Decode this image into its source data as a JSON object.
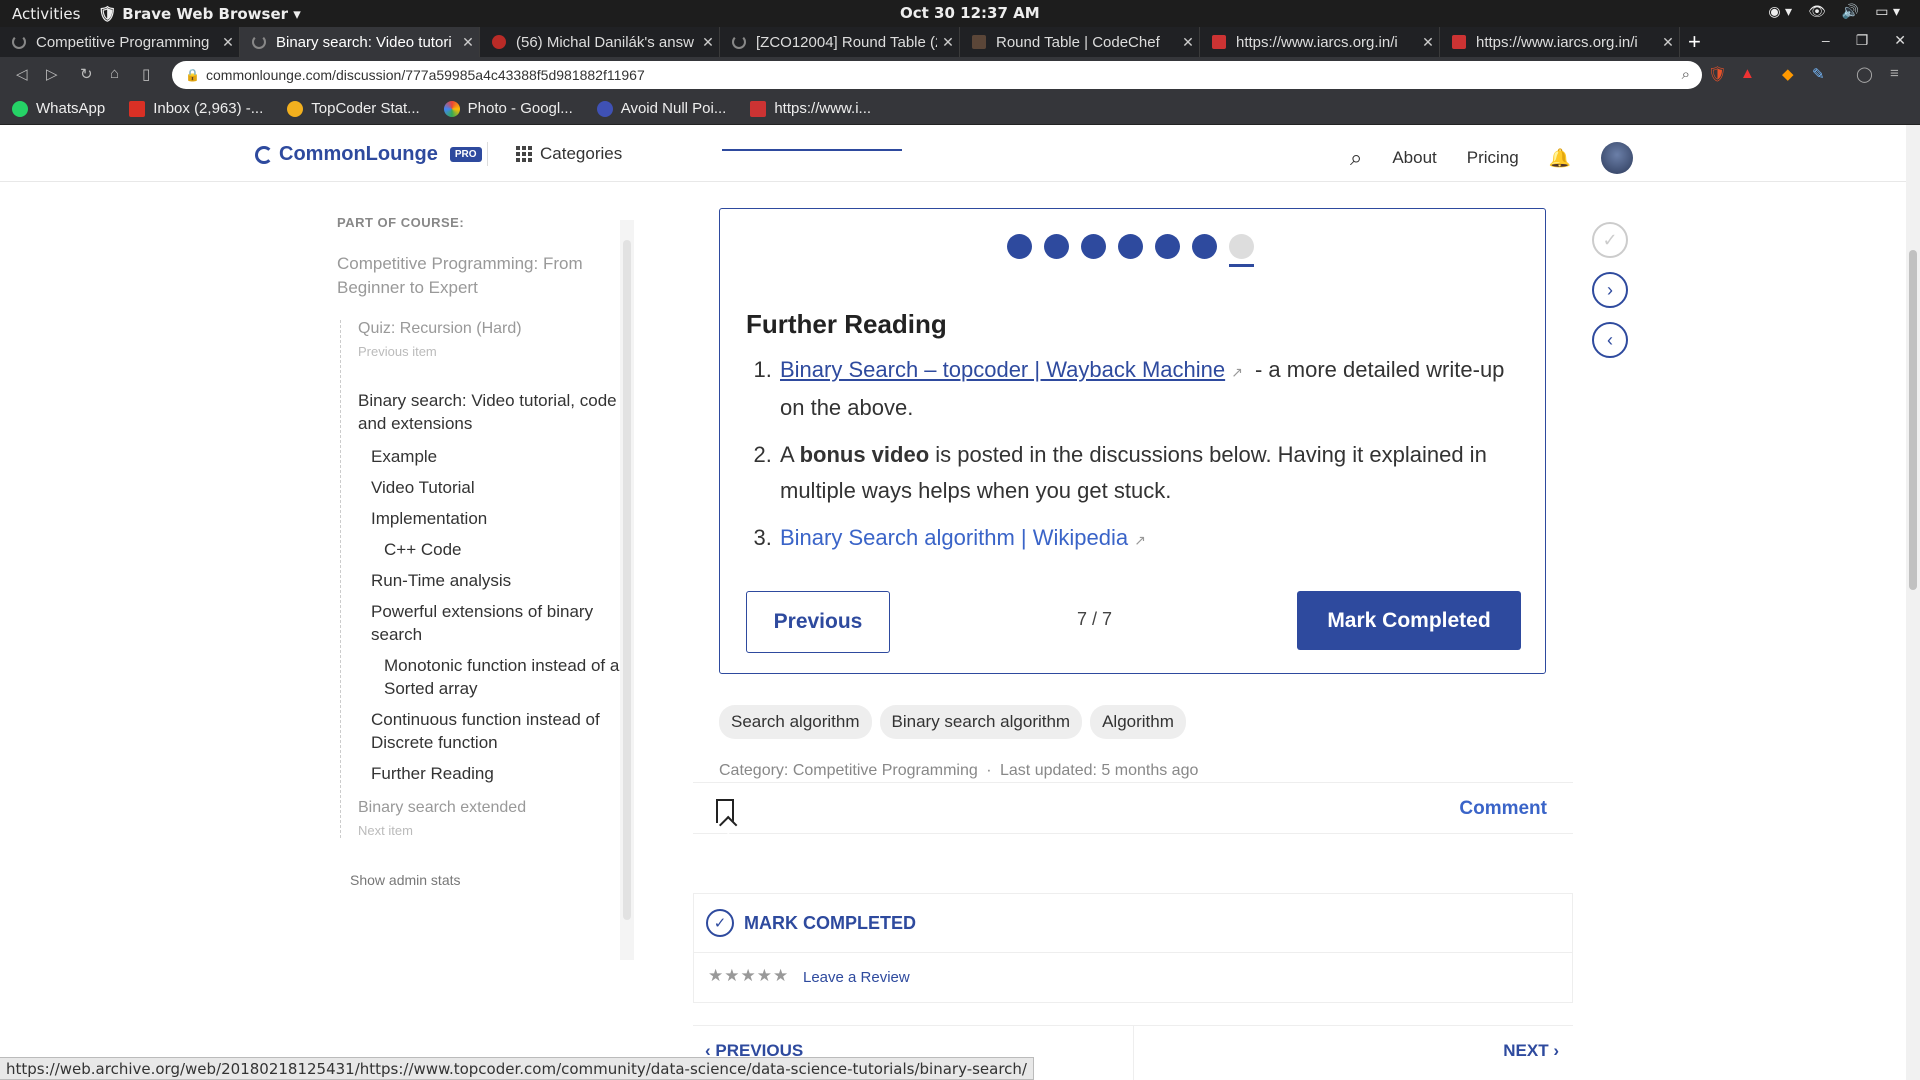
{
  "system": {
    "activities": "Activities",
    "app_name": "Brave Web Browser",
    "clock": "Oct 30  12:37 AM"
  },
  "tabs": [
    {
      "title": "Competitive Programming",
      "active": false
    },
    {
      "title": "Binary search: Video tutori",
      "active": true
    },
    {
      "title": "(56) Michal Danilák's answ",
      "active": false
    },
    {
      "title": "[ZCO12004] Round Table (2",
      "active": false
    },
    {
      "title": "Round Table | CodeChef",
      "active": false
    },
    {
      "title": "https://www.iarcs.org.in/i",
      "active": false
    },
    {
      "title": "https://www.iarcs.org.in/i",
      "active": false
    }
  ],
  "address": {
    "url": "commonlounge.com/discussion/777a59985a4c43388f5d981882f11967"
  },
  "bookmarks": [
    {
      "label": "WhatsApp",
      "color": "#25d366"
    },
    {
      "label": "Inbox (2,963) -...",
      "color": "#d93025"
    },
    {
      "label": "TopCoder Stat...",
      "color": "#f2b01e"
    },
    {
      "label": "Photo - Googl...",
      "color": "#4285f4"
    },
    {
      "label": "Avoid Null Poi...",
      "color": "#3f51b5"
    },
    {
      "label": "https://www.i...",
      "color": "#c33"
    }
  ],
  "header": {
    "brand": "CommonLounge",
    "pro_badge": "PRO",
    "categories": "Categories",
    "about": "About",
    "pricing": "Pricing"
  },
  "sidebar": {
    "heading": "PART OF COURSE:",
    "course": "Competitive Programming: From Beginner to Expert",
    "previous_item": "Quiz: Recursion (Hard)",
    "previous_note": "Previous item",
    "current_item": "Binary search: Video tutorial, code and extensions",
    "subsections": [
      {
        "label": "Example",
        "level": 1
      },
      {
        "label": "Video Tutorial",
        "level": 1
      },
      {
        "label": "Implementation",
        "level": 1
      },
      {
        "label": "C++ Code",
        "level": 2
      },
      {
        "label": "Run-Time analysis",
        "level": 1
      },
      {
        "label": "Powerful extensions of binary search",
        "level": 1
      },
      {
        "label": "Monotonic function instead of a Sorted array",
        "level": 2
      },
      {
        "label": "Continuous function instead of Discrete function",
        "level": 1
      },
      {
        "label": "Further Reading",
        "level": 1
      }
    ],
    "next_item": "Binary search extended",
    "next_note": "Next item",
    "admin": "Show admin stats"
  },
  "card": {
    "progress_done": 6,
    "progress_total": 7,
    "title": "Further Reading",
    "item1_link": "Binary Search – topcoder | Wayback Machine",
    "item1_rest": " - a more detailed write-up on the above.",
    "item2_pre": "A ",
    "item2_bold": "bonus video",
    "item2_rest": " is posted in the discussions below. Having it explained in multiple ways helps when you get stuck.",
    "item3_link": "Binary Search algorithm | Wikipedia",
    "previous_label": "Previous",
    "counter": "7 / 7",
    "mark_label": "Mark Completed"
  },
  "tags": [
    "Search algorithm",
    "Binary search algorithm",
    "Algorithm"
  ],
  "meta": {
    "category": "Category: Competitive Programming",
    "updated": "Last updated: 5 months ago"
  },
  "actions": {
    "comment": "Comment"
  },
  "markbox": {
    "title": "MARK COMPLETED",
    "stars": "★★★★★",
    "review": "Leave a Review"
  },
  "pager": {
    "previous": "‹ PREVIOUS",
    "next": "NEXT ›"
  },
  "status_url": "https://web.archive.org/web/20180218125431/https://www.topcoder.com/community/data-science/data-science-tutorials/binary-search/",
  "colors": {
    "brand": "#2e4a9e"
  }
}
